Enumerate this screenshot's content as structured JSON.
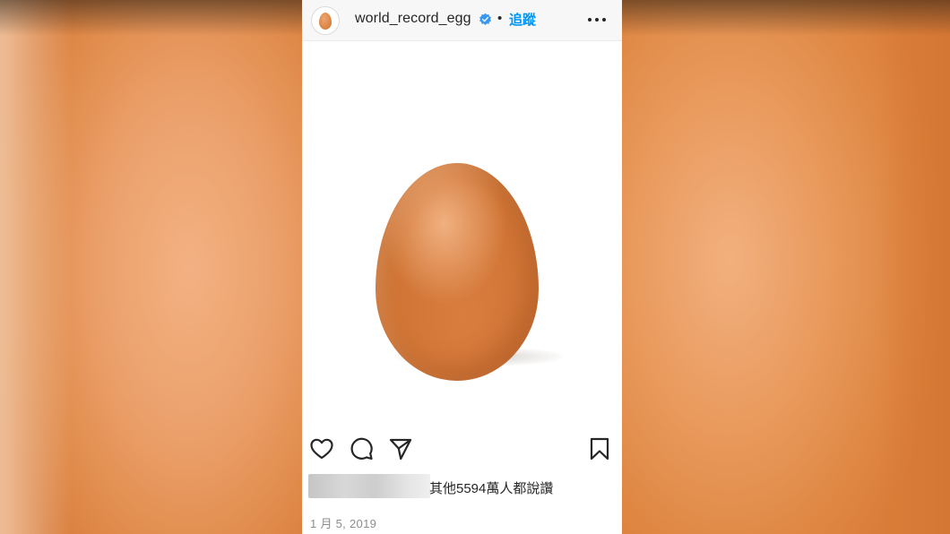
{
  "post": {
    "username": "world_record_egg",
    "separator": "•",
    "follow_label": "追蹤",
    "likes_text": "其他5594萬人都說讚",
    "date": "1 月 5, 2019"
  },
  "icons": {
    "avatar": "egg-avatar-icon",
    "verified": "verified-badge-icon",
    "more": "more-options-icon",
    "like": "heart-icon",
    "comment": "comment-icon",
    "share": "send-icon",
    "save": "bookmark-icon"
  },
  "colors": {
    "follow": "#0095f6",
    "verified": "#3897f0",
    "text": "#262626",
    "muted": "#8e8e8e",
    "egg": "#d27a3a"
  }
}
